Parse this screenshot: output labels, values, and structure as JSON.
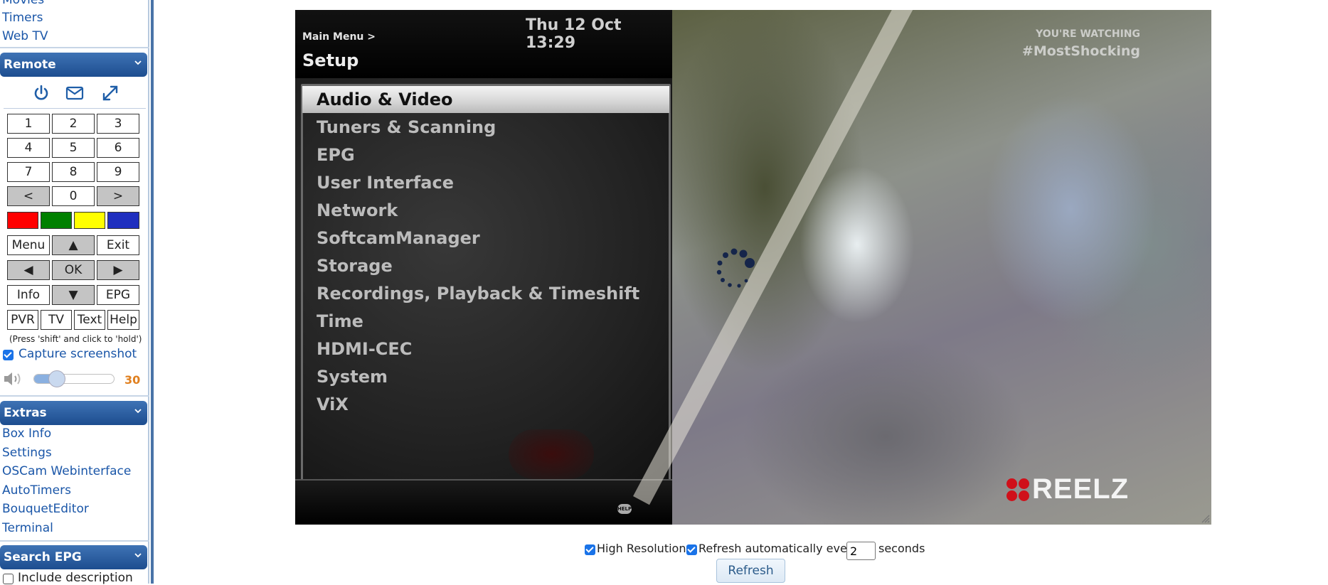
{
  "sidebar": {
    "top_links": [
      "Movies",
      "Timers",
      "Web TV"
    ],
    "remote": {
      "title": "Remote",
      "icons": [
        "power-icon",
        "mail-icon",
        "fullscreen-icon"
      ],
      "keys": {
        "n1": "1",
        "n2": "2",
        "n3": "3",
        "n4": "4",
        "n5": "5",
        "n6": "6",
        "n7": "7",
        "n8": "8",
        "n9": "9",
        "prev": "<",
        "n0": "0",
        "next": ">",
        "menu": "Menu",
        "up": "▲",
        "exit": "Exit",
        "left": "◀",
        "ok": "OK",
        "right": "▶",
        "info": "Info",
        "down": "▼",
        "epg": "EPG",
        "pvr": "PVR",
        "tv": "TV",
        "text": "Text",
        "help": "Help"
      },
      "color_keys": [
        "#ff0000",
        "#008000",
        "#ffff00",
        "#1f2fbf"
      ],
      "hint": "(Press 'shift' and click to 'hold')",
      "capture_label": "Capture screenshot",
      "capture_checked": true,
      "volume": 30,
      "volume_max": 100
    },
    "extras": {
      "title": "Extras",
      "links": [
        "Box Info",
        "Settings",
        "OSCam Webinterface",
        "AutoTimers",
        "BouquetEditor",
        "Terminal"
      ]
    },
    "search_epg": {
      "title": "Search EPG",
      "include_description_label": "Include description",
      "include_description_checked": false
    }
  },
  "screen": {
    "clock": "Thu 12 Oct 13:29",
    "breadcrumb": "Main Menu >",
    "title": "Setup",
    "menu_items": [
      "Audio & Video",
      "Tuners & Scanning",
      "EPG",
      "User Interface",
      "Network",
      "SoftcamManager",
      "Storage",
      "Recordings, Playback & Timeshift",
      "Time",
      "HDMI-CEC",
      "System",
      "ViX"
    ],
    "selected_index": 0,
    "help_badge": "HELP",
    "watermark_line1": "YOU'RE WATCHING",
    "watermark_line2": "#MostShocking",
    "channel_logo": "REELZ"
  },
  "controls": {
    "high_resolution_label": "High Resolution",
    "high_resolution_checked": true,
    "refresh_auto_label": "Refresh automatically every",
    "refresh_auto_checked": true,
    "refresh_interval": "2",
    "seconds_label": "seconds",
    "refresh_button": "Refresh"
  },
  "colors": {
    "accent": "#1d4d8f",
    "link": "#1a56a8",
    "volume_value": "#e08020"
  }
}
